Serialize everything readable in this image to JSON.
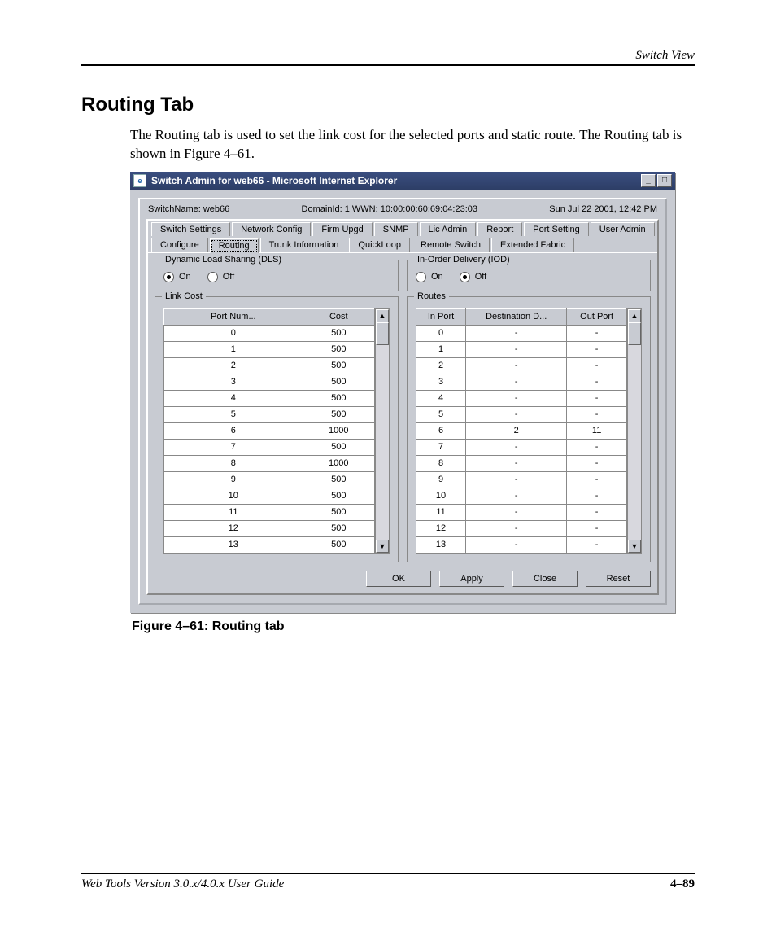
{
  "header": {
    "title": "Switch View"
  },
  "section": {
    "heading": "Routing Tab"
  },
  "body": {
    "p1": "The Routing tab is used to set the link cost for the selected ports and static route. The Routing tab is shown in Figure 4–61."
  },
  "figure": {
    "caption": "Figure 4–61:  Routing tab"
  },
  "footer": {
    "book": "Web Tools Version 3.0.x/4.0.x User Guide",
    "page": "4–89"
  },
  "win": {
    "title": "Switch Admin for web66 - Microsoft Internet Explorer",
    "info": {
      "switchname": "SwitchName: web66",
      "domain": "DomainId: 1 WWN: 10:00:00:60:69:04:23:03",
      "date": "Sun Jul 22  2001, 12:42 PM"
    },
    "tabs_row1": [
      "Switch Settings",
      "Network Config",
      "Firm Upgd",
      "SNMP",
      "Lic Admin",
      "Report",
      "Port Setting",
      "User Admin"
    ],
    "tabs_row2": [
      "Configure",
      "Routing",
      "Trunk Information",
      "QuickLoop",
      "Remote Switch",
      "Extended Fabric"
    ],
    "selected_tab": "Routing",
    "dls": {
      "label": "Dynamic Load Sharing (DLS)",
      "on": "On",
      "off": "Off",
      "value": "On"
    },
    "iod": {
      "label": "In-Order Delivery (IOD)",
      "on": "On",
      "off": "Off",
      "value": "Off"
    },
    "linkcost": {
      "label": "Link Cost",
      "cols": [
        "Port Num...",
        "Cost"
      ],
      "rows": [
        [
          "0",
          "500"
        ],
        [
          "1",
          "500"
        ],
        [
          "2",
          "500"
        ],
        [
          "3",
          "500"
        ],
        [
          "4",
          "500"
        ],
        [
          "5",
          "500"
        ],
        [
          "6",
          "1000"
        ],
        [
          "7",
          "500"
        ],
        [
          "8",
          "1000"
        ],
        [
          "9",
          "500"
        ],
        [
          "10",
          "500"
        ],
        [
          "11",
          "500"
        ],
        [
          "12",
          "500"
        ],
        [
          "13",
          "500"
        ]
      ]
    },
    "routes": {
      "label": "Routes",
      "cols": [
        "In Port",
        "Destination D...",
        "Out Port"
      ],
      "rows": [
        [
          "0",
          "-",
          "-"
        ],
        [
          "1",
          "-",
          "-"
        ],
        [
          "2",
          "-",
          "-"
        ],
        [
          "3",
          "-",
          "-"
        ],
        [
          "4",
          "-",
          "-"
        ],
        [
          "5",
          "-",
          "-"
        ],
        [
          "6",
          "2",
          "11"
        ],
        [
          "7",
          "-",
          "-"
        ],
        [
          "8",
          "-",
          "-"
        ],
        [
          "9",
          "-",
          "-"
        ],
        [
          "10",
          "-",
          "-"
        ],
        [
          "11",
          "-",
          "-"
        ],
        [
          "12",
          "-",
          "-"
        ],
        [
          "13",
          "-",
          "-"
        ]
      ]
    },
    "buttons": {
      "ok": "OK",
      "apply": "Apply",
      "close": "Close",
      "reset": "Reset"
    }
  }
}
